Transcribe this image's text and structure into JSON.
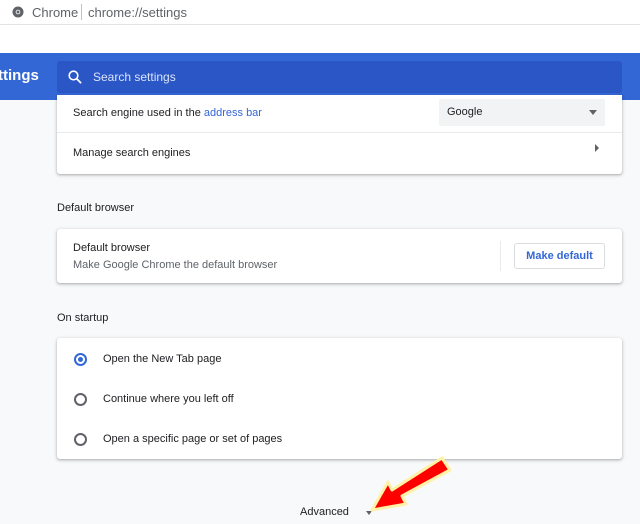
{
  "omnibox": {
    "site_name": "Chrome",
    "url": "chrome://settings"
  },
  "toolbar": {
    "page_title": "ttings",
    "search_placeholder": "Search settings",
    "search_value": ""
  },
  "search_engine": {
    "label_prefix": "Search engine used in the ",
    "label_link": "address bar",
    "selected_engine": "Google",
    "manage_label": "Manage search engines"
  },
  "default_browser": {
    "section_title": "Default browser",
    "primary_text": "Default browser",
    "secondary_text": "Make Google Chrome the default browser",
    "button_label": "Make default"
  },
  "on_startup": {
    "section_title": "On startup",
    "options": [
      {
        "label": "Open the New Tab page",
        "checked": true
      },
      {
        "label": "Continue where you left off",
        "checked": false
      },
      {
        "label": "Open a specific page or set of pages",
        "checked": false
      }
    ]
  },
  "advanced": {
    "label": "Advanced"
  },
  "colors": {
    "toolbar_blue": "#3367d6",
    "search_box_blue": "#2a56c6",
    "link_blue": "#3367d6",
    "annotation_red": "#ff0000"
  },
  "icons": {
    "site": "chrome-icon",
    "search": "search-icon",
    "select_caret": "caret-down-icon",
    "manage_chevron": "chevron-right-icon",
    "advanced_caret": "caret-down-icon",
    "annotation": "red-arrow-icon"
  }
}
